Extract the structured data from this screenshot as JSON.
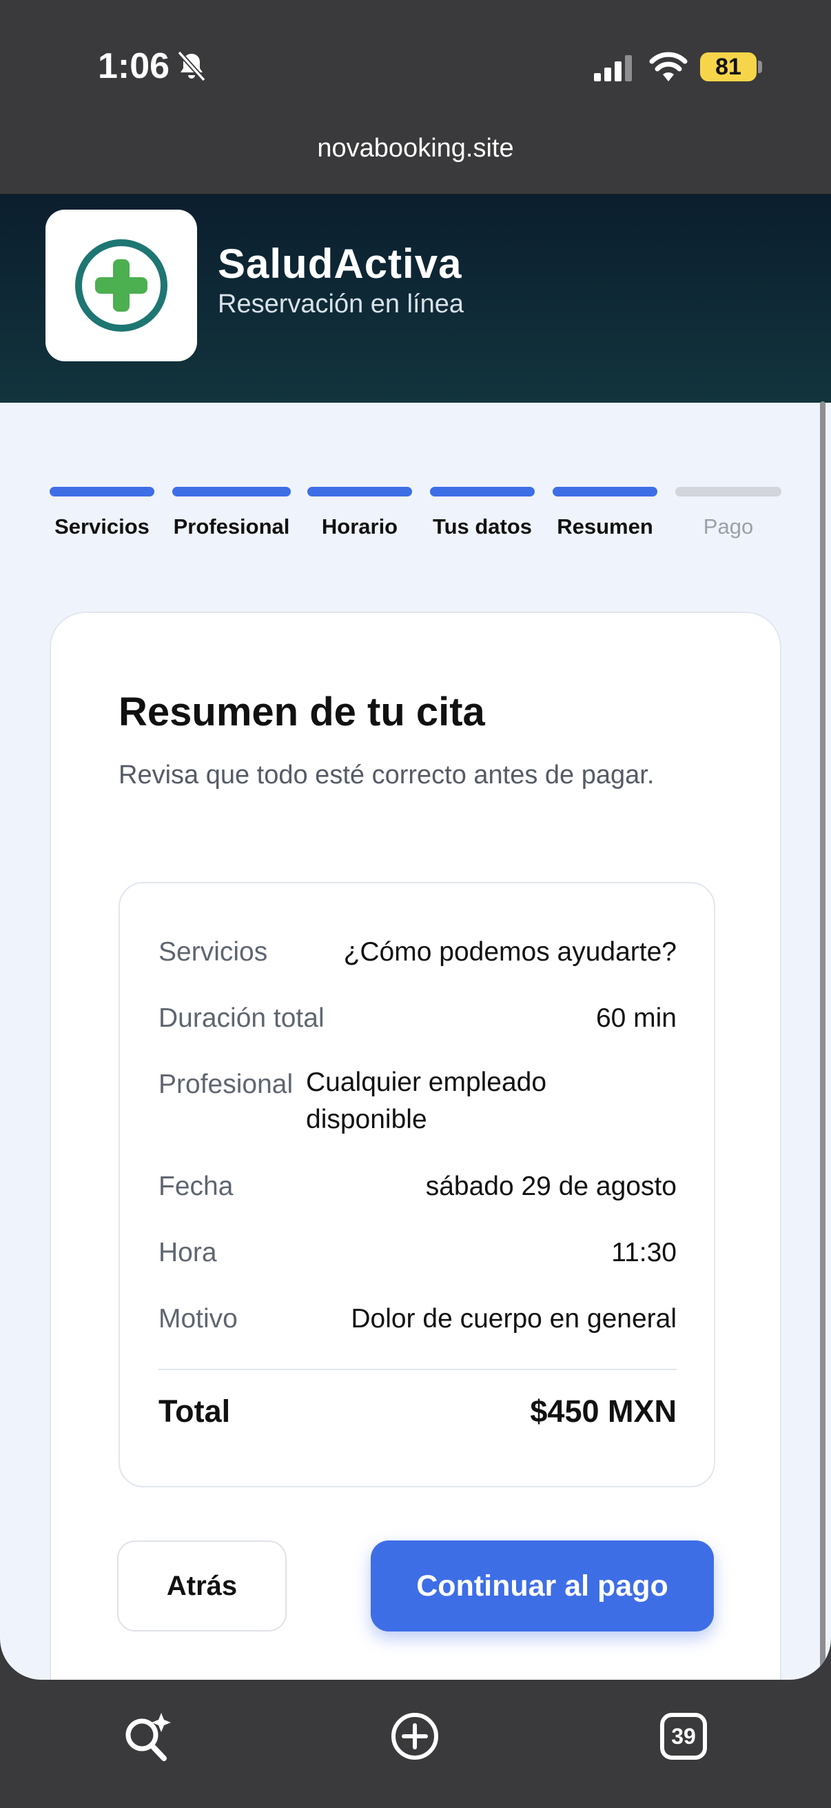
{
  "status_bar": {
    "time": "1:06",
    "battery": "81",
    "icons": [
      "bell-slash-icon",
      "signal-icon",
      "wifi-icon",
      "battery-icon"
    ]
  },
  "browser": {
    "url": "novabooking.site",
    "tabs_count": "39"
  },
  "brand": {
    "name": "SaludActiva",
    "subtitle": "Reservación en línea",
    "logo_color": "#1e7672",
    "logo_cross_color": "#4caf50"
  },
  "steps": [
    {
      "label": "Servicios",
      "active": true
    },
    {
      "label": "Profesional",
      "active": true
    },
    {
      "label": "Horario",
      "active": true
    },
    {
      "label": "Tus datos",
      "active": true
    },
    {
      "label": "Resumen",
      "active": true
    },
    {
      "label": "Pago",
      "active": false
    }
  ],
  "summary": {
    "title": "Resumen de tu cita",
    "subtitle": "Revisa que todo esté correcto antes de pagar.",
    "rows": [
      {
        "label": "Servicios",
        "value": "¿Cómo podemos ayudarte?"
      },
      {
        "label": "Duración total",
        "value": "60 min"
      },
      {
        "label": "Profesional",
        "value": "Cualquier empleado disponible"
      },
      {
        "label": "Fecha",
        "value": "sábado 29 de agosto"
      },
      {
        "label": "Hora",
        "value": "11:30"
      },
      {
        "label": "Motivo",
        "value": "Dolor de cuerpo en general"
      }
    ],
    "total_label": "Total",
    "total_value": "$450 MXN"
  },
  "actions": {
    "back_label": "Atrás",
    "pay_label": "Continuar al pago"
  },
  "colors": {
    "accent": "#3e6ee6",
    "step_inactive": "#d2d5dc",
    "hero_dark": "#0b1e2e"
  }
}
